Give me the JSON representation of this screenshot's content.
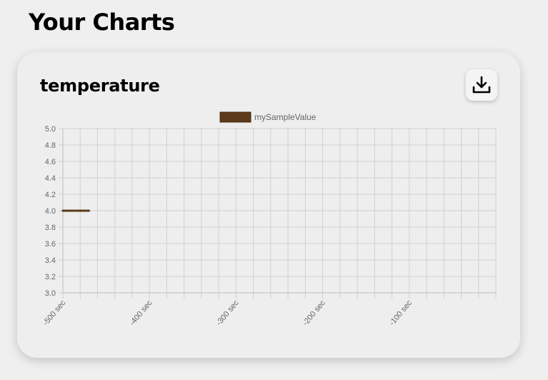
{
  "page": {
    "title": "Your Charts"
  },
  "card": {
    "title": "temperature",
    "download_icon": "download-icon"
  },
  "chart_data": {
    "type": "line",
    "title": "",
    "xlabel": "",
    "ylabel": "",
    "x_ticks": [
      "-500 sec",
      "-400 sec",
      "-300 sec",
      "-200 sec",
      "-100 sec"
    ],
    "x_range": [
      -500,
      0
    ],
    "ylim": [
      3.0,
      5.0
    ],
    "y_ticks": [
      "5.0",
      "4.8",
      "4.6",
      "4.4",
      "4.2",
      "4.0",
      "3.8",
      "3.6",
      "3.4",
      "3.2",
      "3.0"
    ],
    "grid": true,
    "legend_position": "top-center",
    "series": [
      {
        "name": "mySampleValue",
        "color": "#5c3a1a",
        "x": [
          -500,
          -470
        ],
        "y": [
          4.0,
          4.0
        ]
      }
    ]
  }
}
